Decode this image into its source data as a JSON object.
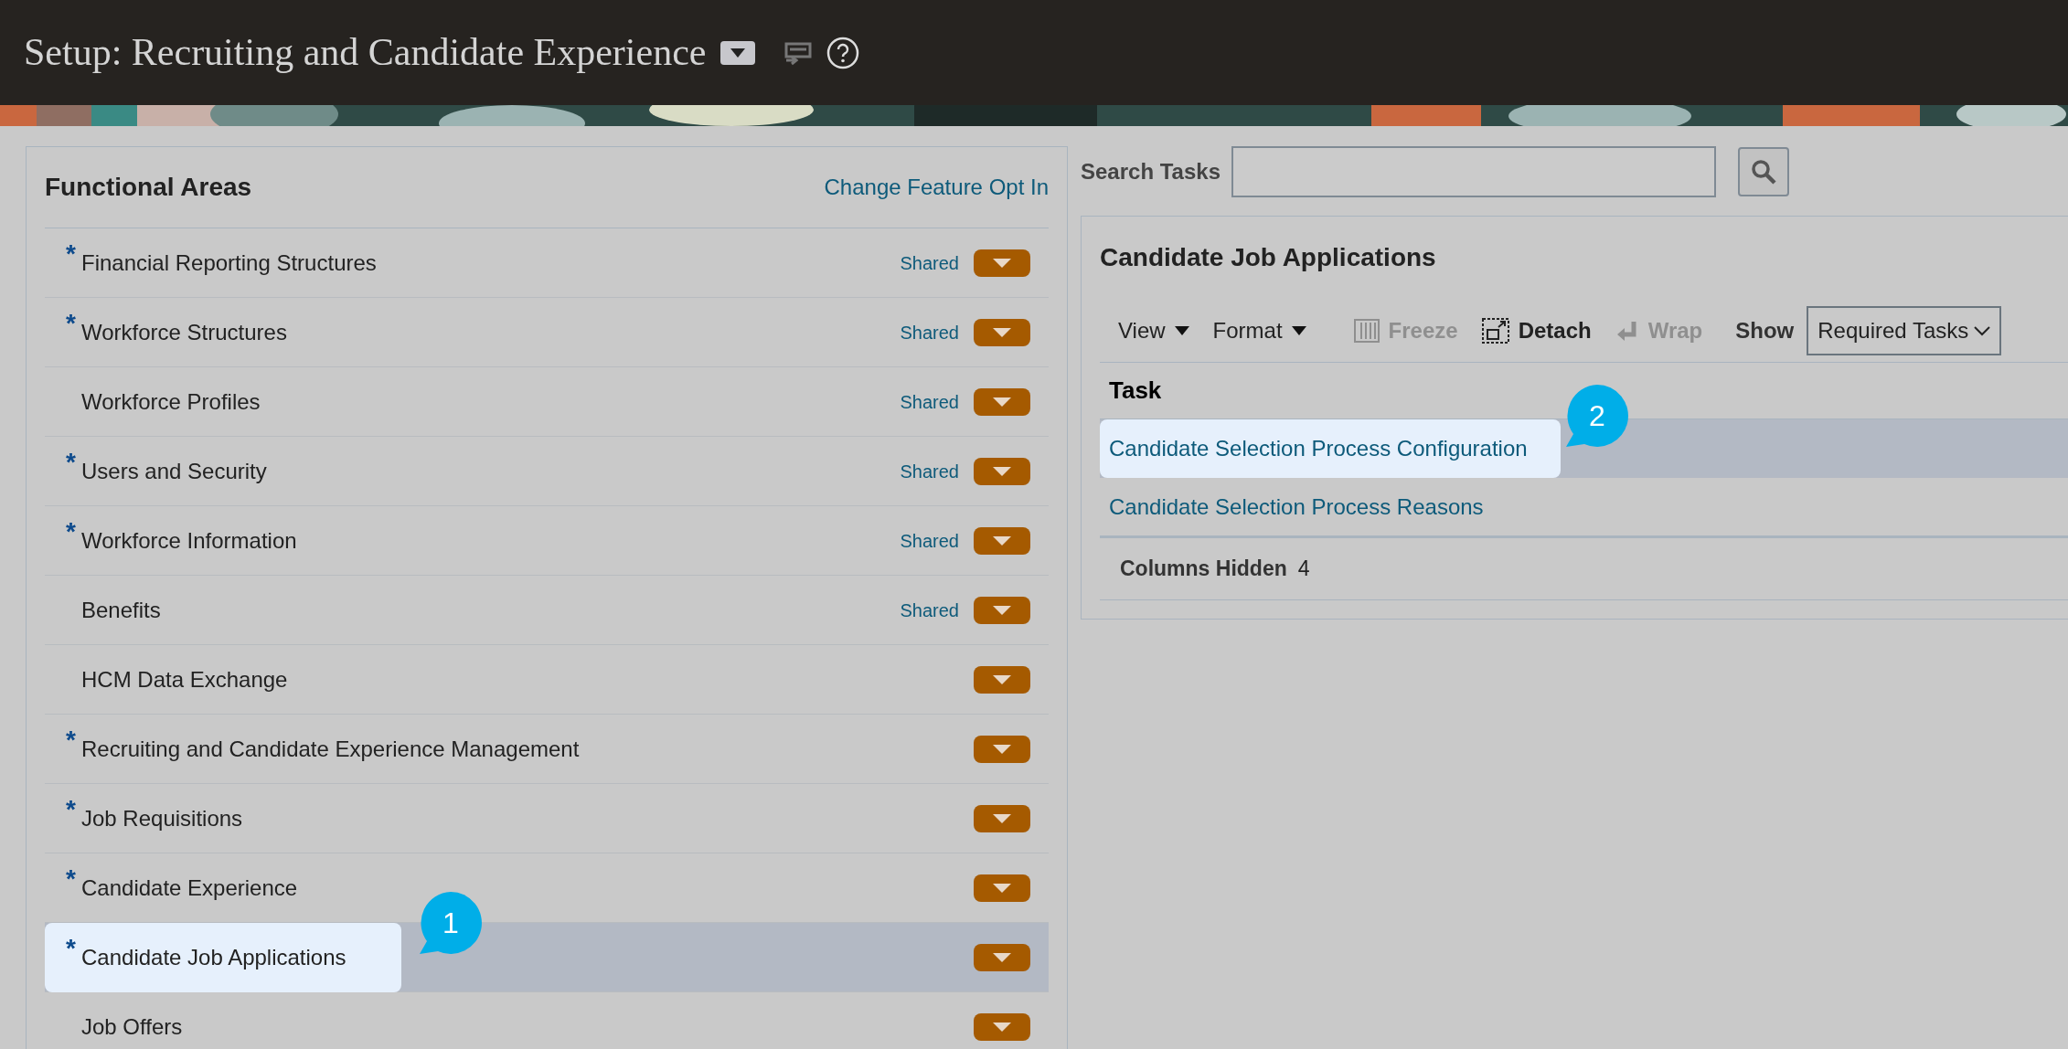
{
  "header": {
    "title": "Setup: Recruiting and Candidate Experience"
  },
  "functional_areas": {
    "title": "Functional Areas",
    "link": "Change Feature Opt In",
    "rows": [
      {
        "mark": "*",
        "label": "Financial Reporting Structures",
        "shared": "Shared",
        "selected": false
      },
      {
        "mark": "*",
        "label": "Workforce Structures",
        "shared": "Shared",
        "selected": false
      },
      {
        "label": "Workforce Profiles",
        "shared": "Shared",
        "selected": false
      },
      {
        "mark": "*",
        "label": "Users and Security",
        "shared": "Shared",
        "selected": false
      },
      {
        "mark": "*",
        "label": "Workforce Information",
        "shared": "Shared",
        "selected": false
      },
      {
        "label": "Benefits",
        "shared": "Shared",
        "selected": false
      },
      {
        "label": "HCM Data Exchange",
        "selected": false
      },
      {
        "mark": "*",
        "label": "Recruiting and Candidate Experience Management",
        "selected": false
      },
      {
        "mark": "*",
        "label": "Job Requisitions",
        "selected": false
      },
      {
        "mark": "*",
        "label": "Candidate Experience",
        "selected": false
      },
      {
        "mark": "*",
        "label": "Candidate Job Applications",
        "selected": true,
        "callout": "1"
      },
      {
        "label": "Job Offers",
        "selected": false
      }
    ]
  },
  "search": {
    "label": "Search Tasks"
  },
  "tasks": {
    "title": "Candidate Job Applications",
    "toolbar": [
      {
        "label": "View",
        "kind": "menu",
        "disabled": false
      },
      {
        "label": "Format",
        "kind": "menu",
        "disabled": false
      },
      {
        "label": "Freeze",
        "kind": "freeze",
        "disabled": true
      },
      {
        "label": "Detach",
        "kind": "detach",
        "disabled": false
      },
      {
        "label": "Wrap",
        "kind": "wrap",
        "disabled": true
      }
    ],
    "show_label": "Show",
    "show_value": "Required Tasks",
    "column": "Task",
    "rows": [
      {
        "label": "Candidate Selection Process Configuration",
        "selected": true,
        "callout": "2"
      },
      {
        "label": "Candidate Selection Process Reasons",
        "selected": false
      }
    ],
    "footer_label": "Columns Hidden",
    "footer_value": "4"
  }
}
